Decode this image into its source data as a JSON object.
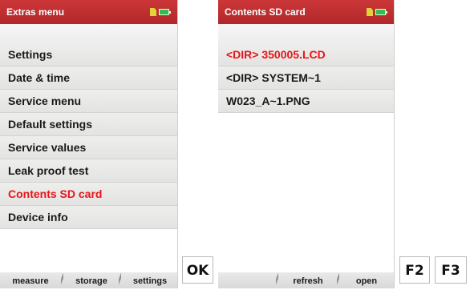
{
  "left_screen": {
    "title": "Extras menu",
    "menu": [
      {
        "label": "Settings"
      },
      {
        "label": "Date & time"
      },
      {
        "label": "Service menu"
      },
      {
        "label": "Default settings"
      },
      {
        "label": "Service values"
      },
      {
        "label": "Leak proof test"
      },
      {
        "label": "Contents SD card",
        "selected": true
      },
      {
        "label": "Device info"
      }
    ],
    "softkeys": [
      "measure",
      "storage",
      "settings"
    ]
  },
  "right_screen": {
    "title": "Contents SD card",
    "files": [
      {
        "label": "<DIR> 350005.LCD",
        "selected": true
      },
      {
        "label": "<DIR> SYSTEM~1"
      },
      {
        "label": "W023_A~1.PNG"
      }
    ],
    "softkeys": [
      "",
      "refresh",
      "open"
    ]
  },
  "hardware_keys": [
    "OK",
    "F2",
    "F3"
  ],
  "icons": [
    "sd-card-icon",
    "battery-icon"
  ],
  "colors": {
    "title_bar": "#c0302f",
    "selected_text": "#e8141a",
    "battery": "#2ec04a",
    "sd_card": "#e2d23a"
  }
}
